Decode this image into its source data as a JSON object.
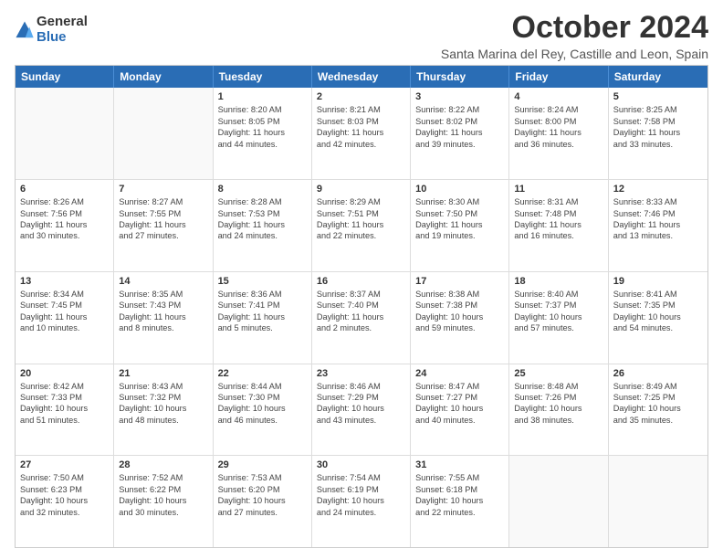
{
  "logo": {
    "general": "General",
    "blue": "Blue"
  },
  "title": "October 2024",
  "subtitle": "Santa Marina del Rey, Castille and Leon, Spain",
  "header_days": [
    "Sunday",
    "Monday",
    "Tuesday",
    "Wednesday",
    "Thursday",
    "Friday",
    "Saturday"
  ],
  "weeks": [
    [
      {
        "day": "",
        "lines": []
      },
      {
        "day": "",
        "lines": []
      },
      {
        "day": "1",
        "lines": [
          "Sunrise: 8:20 AM",
          "Sunset: 8:05 PM",
          "Daylight: 11 hours",
          "and 44 minutes."
        ]
      },
      {
        "day": "2",
        "lines": [
          "Sunrise: 8:21 AM",
          "Sunset: 8:03 PM",
          "Daylight: 11 hours",
          "and 42 minutes."
        ]
      },
      {
        "day": "3",
        "lines": [
          "Sunrise: 8:22 AM",
          "Sunset: 8:02 PM",
          "Daylight: 11 hours",
          "and 39 minutes."
        ]
      },
      {
        "day": "4",
        "lines": [
          "Sunrise: 8:24 AM",
          "Sunset: 8:00 PM",
          "Daylight: 11 hours",
          "and 36 minutes."
        ]
      },
      {
        "day": "5",
        "lines": [
          "Sunrise: 8:25 AM",
          "Sunset: 7:58 PM",
          "Daylight: 11 hours",
          "and 33 minutes."
        ]
      }
    ],
    [
      {
        "day": "6",
        "lines": [
          "Sunrise: 8:26 AM",
          "Sunset: 7:56 PM",
          "Daylight: 11 hours",
          "and 30 minutes."
        ]
      },
      {
        "day": "7",
        "lines": [
          "Sunrise: 8:27 AM",
          "Sunset: 7:55 PM",
          "Daylight: 11 hours",
          "and 27 minutes."
        ]
      },
      {
        "day": "8",
        "lines": [
          "Sunrise: 8:28 AM",
          "Sunset: 7:53 PM",
          "Daylight: 11 hours",
          "and 24 minutes."
        ]
      },
      {
        "day": "9",
        "lines": [
          "Sunrise: 8:29 AM",
          "Sunset: 7:51 PM",
          "Daylight: 11 hours",
          "and 22 minutes."
        ]
      },
      {
        "day": "10",
        "lines": [
          "Sunrise: 8:30 AM",
          "Sunset: 7:50 PM",
          "Daylight: 11 hours",
          "and 19 minutes."
        ]
      },
      {
        "day": "11",
        "lines": [
          "Sunrise: 8:31 AM",
          "Sunset: 7:48 PM",
          "Daylight: 11 hours",
          "and 16 minutes."
        ]
      },
      {
        "day": "12",
        "lines": [
          "Sunrise: 8:33 AM",
          "Sunset: 7:46 PM",
          "Daylight: 11 hours",
          "and 13 minutes."
        ]
      }
    ],
    [
      {
        "day": "13",
        "lines": [
          "Sunrise: 8:34 AM",
          "Sunset: 7:45 PM",
          "Daylight: 11 hours",
          "and 10 minutes."
        ]
      },
      {
        "day": "14",
        "lines": [
          "Sunrise: 8:35 AM",
          "Sunset: 7:43 PM",
          "Daylight: 11 hours",
          "and 8 minutes."
        ]
      },
      {
        "day": "15",
        "lines": [
          "Sunrise: 8:36 AM",
          "Sunset: 7:41 PM",
          "Daylight: 11 hours",
          "and 5 minutes."
        ]
      },
      {
        "day": "16",
        "lines": [
          "Sunrise: 8:37 AM",
          "Sunset: 7:40 PM",
          "Daylight: 11 hours",
          "and 2 minutes."
        ]
      },
      {
        "day": "17",
        "lines": [
          "Sunrise: 8:38 AM",
          "Sunset: 7:38 PM",
          "Daylight: 10 hours",
          "and 59 minutes."
        ]
      },
      {
        "day": "18",
        "lines": [
          "Sunrise: 8:40 AM",
          "Sunset: 7:37 PM",
          "Daylight: 10 hours",
          "and 57 minutes."
        ]
      },
      {
        "day": "19",
        "lines": [
          "Sunrise: 8:41 AM",
          "Sunset: 7:35 PM",
          "Daylight: 10 hours",
          "and 54 minutes."
        ]
      }
    ],
    [
      {
        "day": "20",
        "lines": [
          "Sunrise: 8:42 AM",
          "Sunset: 7:33 PM",
          "Daylight: 10 hours",
          "and 51 minutes."
        ]
      },
      {
        "day": "21",
        "lines": [
          "Sunrise: 8:43 AM",
          "Sunset: 7:32 PM",
          "Daylight: 10 hours",
          "and 48 minutes."
        ]
      },
      {
        "day": "22",
        "lines": [
          "Sunrise: 8:44 AM",
          "Sunset: 7:30 PM",
          "Daylight: 10 hours",
          "and 46 minutes."
        ]
      },
      {
        "day": "23",
        "lines": [
          "Sunrise: 8:46 AM",
          "Sunset: 7:29 PM",
          "Daylight: 10 hours",
          "and 43 minutes."
        ]
      },
      {
        "day": "24",
        "lines": [
          "Sunrise: 8:47 AM",
          "Sunset: 7:27 PM",
          "Daylight: 10 hours",
          "and 40 minutes."
        ]
      },
      {
        "day": "25",
        "lines": [
          "Sunrise: 8:48 AM",
          "Sunset: 7:26 PM",
          "Daylight: 10 hours",
          "and 38 minutes."
        ]
      },
      {
        "day": "26",
        "lines": [
          "Sunrise: 8:49 AM",
          "Sunset: 7:25 PM",
          "Daylight: 10 hours",
          "and 35 minutes."
        ]
      }
    ],
    [
      {
        "day": "27",
        "lines": [
          "Sunrise: 7:50 AM",
          "Sunset: 6:23 PM",
          "Daylight: 10 hours",
          "and 32 minutes."
        ]
      },
      {
        "day": "28",
        "lines": [
          "Sunrise: 7:52 AM",
          "Sunset: 6:22 PM",
          "Daylight: 10 hours",
          "and 30 minutes."
        ]
      },
      {
        "day": "29",
        "lines": [
          "Sunrise: 7:53 AM",
          "Sunset: 6:20 PM",
          "Daylight: 10 hours",
          "and 27 minutes."
        ]
      },
      {
        "day": "30",
        "lines": [
          "Sunrise: 7:54 AM",
          "Sunset: 6:19 PM",
          "Daylight: 10 hours",
          "and 24 minutes."
        ]
      },
      {
        "day": "31",
        "lines": [
          "Sunrise: 7:55 AM",
          "Sunset: 6:18 PM",
          "Daylight: 10 hours",
          "and 22 minutes."
        ]
      },
      {
        "day": "",
        "lines": []
      },
      {
        "day": "",
        "lines": []
      }
    ]
  ]
}
